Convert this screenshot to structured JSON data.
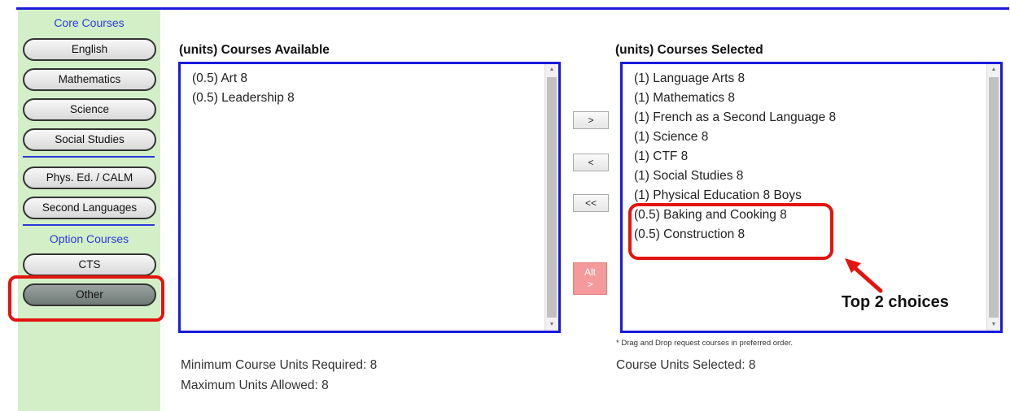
{
  "sidebar": {
    "core_title": "Core Courses",
    "core_buttons": [
      "English",
      "Mathematics",
      "Science",
      "Social Studies"
    ],
    "extra_buttons": [
      "Phys. Ed. / CALM",
      "Second Languages"
    ],
    "option_title": "Option Courses",
    "option_buttons": [
      "CTS",
      "Other"
    ]
  },
  "available": {
    "title": "(units) Courses Available",
    "items": [
      "(0.5) Art 8",
      "(0.5) Leadership 8"
    ],
    "min_units": "Minimum Course Units Required: 8",
    "max_units": "Maximum Units Allowed: 8"
  },
  "controls": {
    "add": ">",
    "remove": "<",
    "remove_all": "<<",
    "alt_line1": "Alt",
    "alt_line2": ">"
  },
  "selected": {
    "title": "(units) Courses Selected",
    "items": [
      "(1) Language Arts 8",
      "(1) Mathematics 8",
      "(1) French as a Second Language 8",
      "(1) Science 8",
      "(1) CTF 8",
      "(1) Social Studies 8",
      "(1) Physical Education 8 Boys",
      "(0.5) Baking and Cooking 8",
      "(0.5) Construction 8"
    ],
    "note": "* Drag and Drop request courses in preferred order.",
    "units_selected": "Course Units Selected: 8"
  },
  "annotation": {
    "label": "Top 2 choices",
    "color": "#e3140f"
  },
  "colors": {
    "sidebar_bg": "#d3efc8",
    "accent_blue": "#1a1adc",
    "highlight_red": "#e3140f",
    "alt_button": "#f49a9a"
  }
}
